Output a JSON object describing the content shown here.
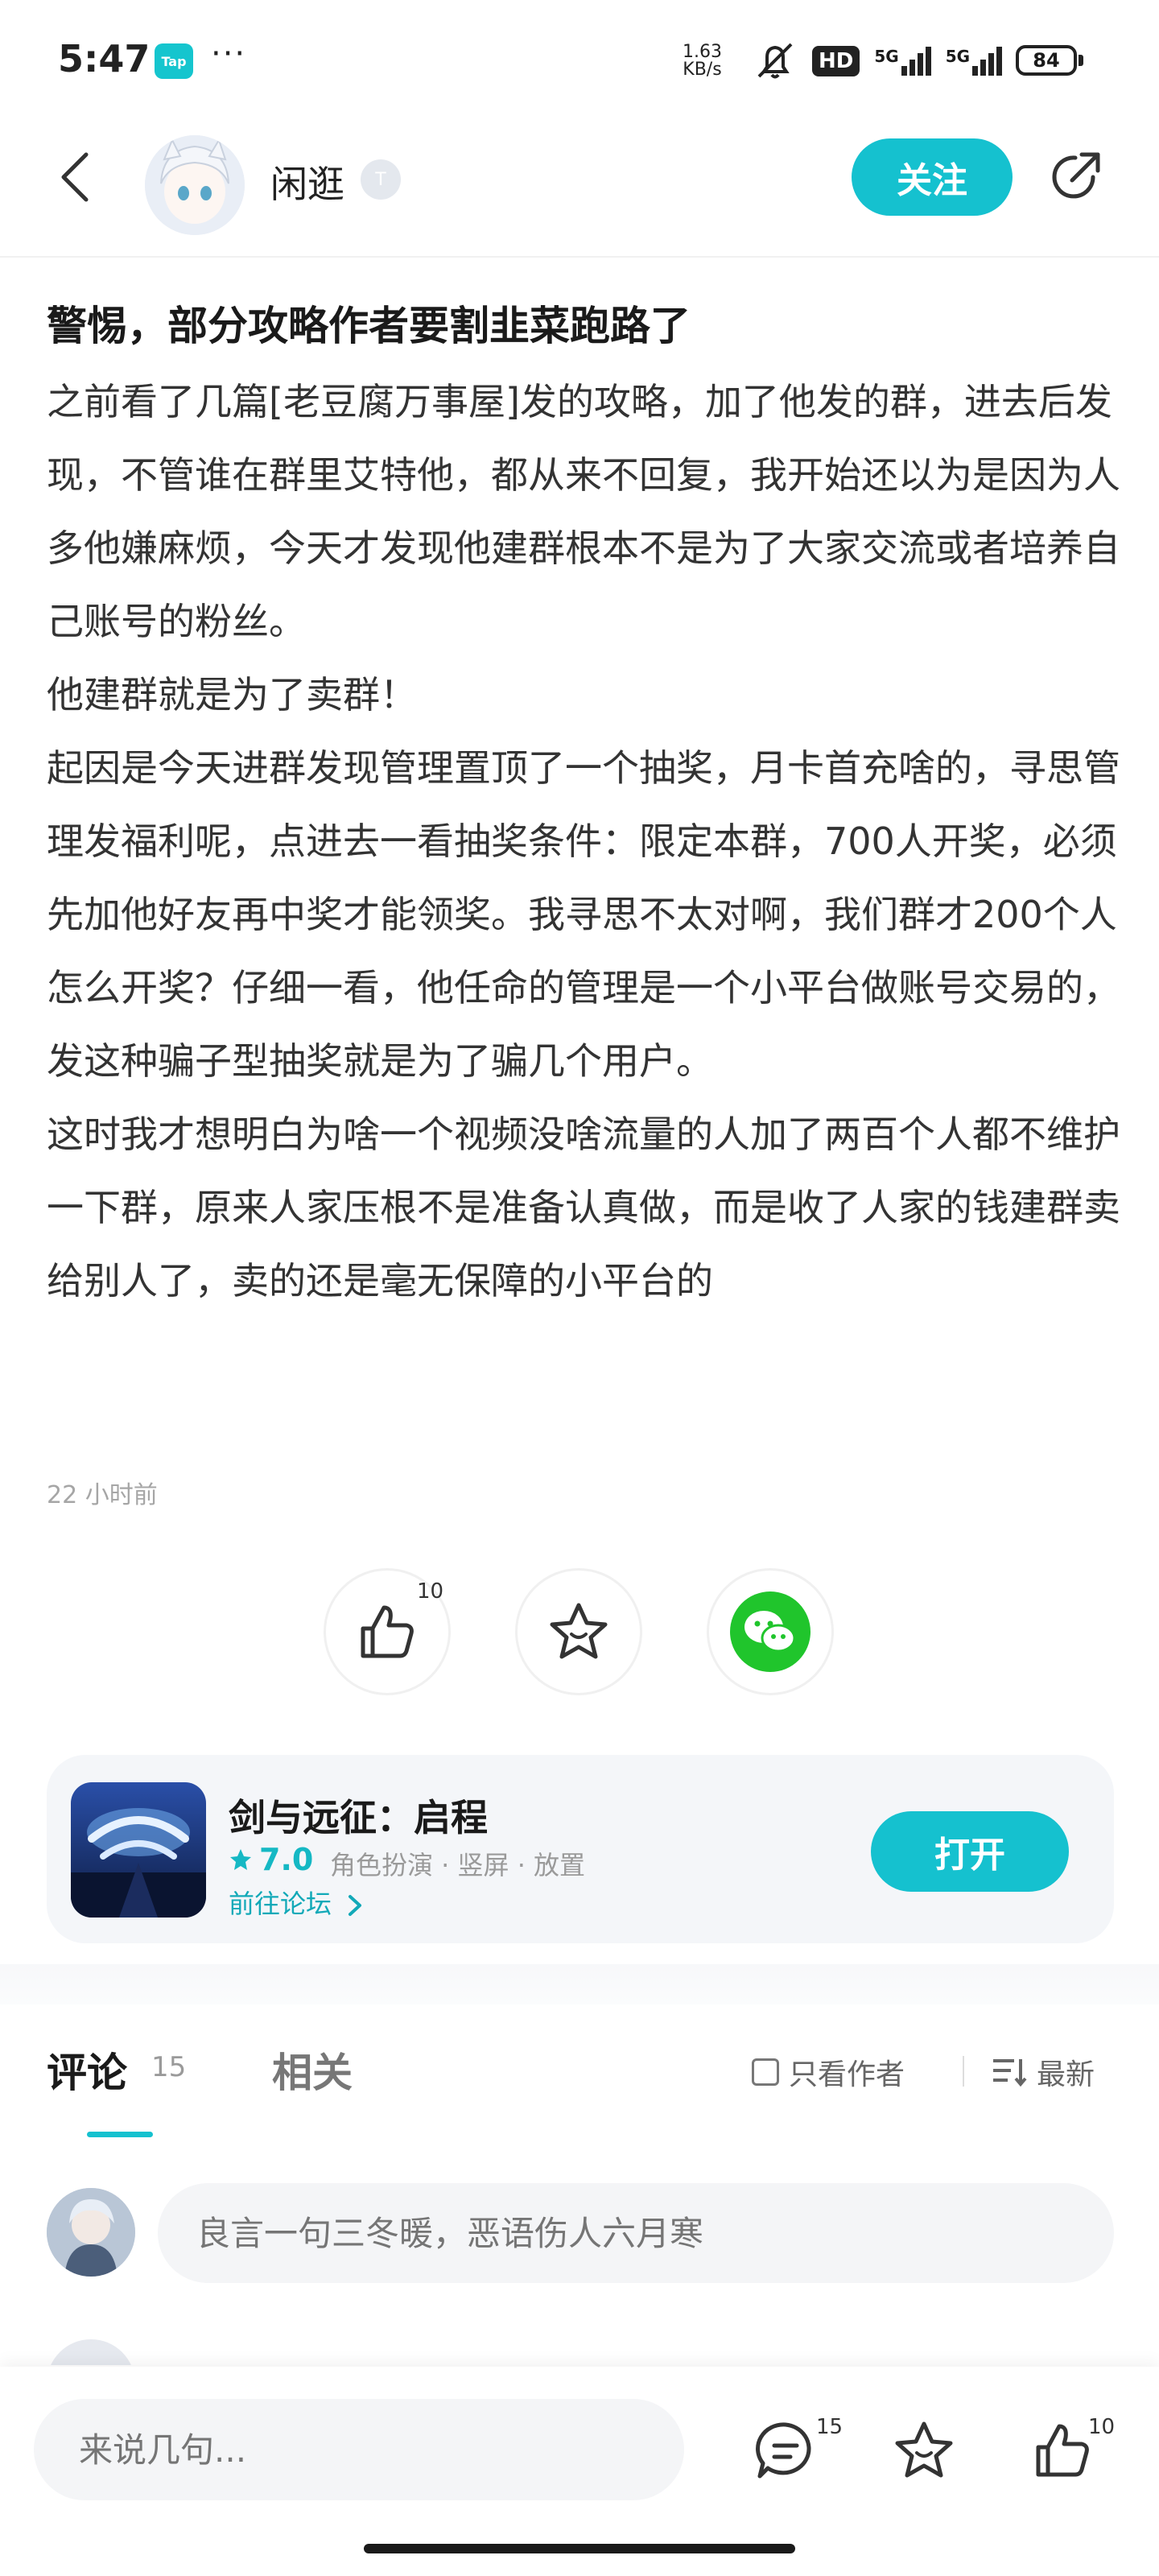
{
  "status_bar": {
    "time": "5:47",
    "app_badge": "Tap",
    "speed_value": "1.63",
    "speed_unit": "KB/s",
    "signal_1": "5G",
    "signal_2": "5G",
    "hd_label": "HD",
    "battery": "84"
  },
  "header": {
    "author_name": "闲逛",
    "level_badge": "T",
    "follow_label": "关注"
  },
  "post": {
    "title": "警惕，部分攻略作者要割韭菜跑路了",
    "paragraphs": [
      "之前看了几篇[老豆腐万事屋]发的攻略，加了他发的群，进去后发现，不管谁在群里艾特他，都从来不回复，我开始还以为是因为人多他嫌麻烦，今天才发现他建群根本不是为了大家交流或者培养自己账号的粉丝。",
      "他建群就是为了卖群！",
      "起因是今天进群发现管理置顶了一个抽奖，月卡首充啥的，寻思管理发福利呢，点进去一看抽奖条件：限定本群，700人开奖，必须先加他好友再中奖才能领奖。我寻思不太对啊，我们群才200个人怎么开奖？仔细一看，他任命的管理是一个小平台做账号交易的，发这种骗子型抽奖就是为了骗几个用户。",
      "这时我才想明白为啥一个视频没啥流量的人加了两百个人都不维护一下群，原来人家压根不是准备认真做，而是收了人家的钱建群卖给别人了，卖的还是毫无保障的小平台的"
    ],
    "time": "22 小时前",
    "like_count": "10"
  },
  "game_card": {
    "name": "剑与远征：启程",
    "rating": "7.0",
    "tags": "角色扮演 · 竖屏 · 放置",
    "forum_link": "前往论坛",
    "open_label": "打开"
  },
  "comments": {
    "tab_comments": "评论",
    "comment_count": "15",
    "tab_related": "相关",
    "author_only": "只看作者",
    "sort_label": "最新",
    "input_placeholder": "良言一句三冬暖，恶语伤人六月寒"
  },
  "bottom_bar": {
    "input_placeholder": "来说几句...",
    "comment_count": "15",
    "like_count": "10"
  },
  "colors": {
    "accent": "#15c1cf",
    "wechat": "#20c52c"
  }
}
